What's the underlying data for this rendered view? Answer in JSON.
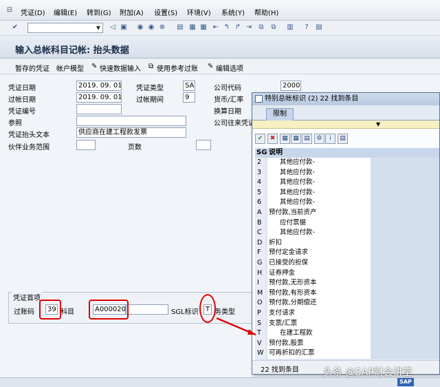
{
  "menu": {
    "items": [
      "凭证(D)",
      "编辑(E)",
      "转到(G)",
      "附加(A)",
      "设置(S)",
      "环境(V)",
      "系统(Y)",
      "帮助(H)"
    ]
  },
  "title": "输入总帐科目记帐: 抬头数据",
  "app_toolbar": {
    "b1": "暂存的凭证",
    "b2": "帐户模型",
    "b3": "快速数据输入",
    "b4": "使用参考过账",
    "b5": "编辑选项"
  },
  "header": {
    "doc_date_label": "凭证日期",
    "doc_date": "2019. 09. 01",
    "doc_type_label": "凭证类型",
    "doc_type": "SA",
    "company_code_label": "公司代码",
    "company_code": "2000",
    "post_date_label": "过帐日期",
    "post_date": "2019. 09. 01",
    "period_label": "过帐期间",
    "period": "9",
    "currency_label": "货币/汇率",
    "doc_no_label": "凭证编号",
    "trans_date_label": "换算日期",
    "reference_label": "参照",
    "cross_cc_label": "公司往来凭证",
    "header_text_label": "凭证抬头文本",
    "header_text": "供应商在建工程款发票",
    "partner_label": "伙伴业务范围",
    "pages_label": "页数"
  },
  "first_item": {
    "section_label": "凭证首项",
    "posting_key_label": "过账码",
    "posting_key": "39",
    "account_label": "科目",
    "account": "A000020",
    "sgl_label": "SGL标识",
    "sgl": "T",
    "trans_type_label": "务类型"
  },
  "popup": {
    "title": "特别总帐标识 (2)   22 找到条目",
    "tab": "限制",
    "col_sg": "SG",
    "col_desc": "说明",
    "rows": [
      {
        "sg": "2",
        "desc": "其他应付款-"
      },
      {
        "sg": "3",
        "desc": "其他应付款-"
      },
      {
        "sg": "4",
        "desc": "其他应付款-"
      },
      {
        "sg": "5",
        "desc": "其他应付款-"
      },
      {
        "sg": "6",
        "desc": "其他应付款-"
      },
      {
        "sg": "A",
        "desc": "预付款,当前资产"
      },
      {
        "sg": "B",
        "desc": "应付票据"
      },
      {
        "sg": "C",
        "desc": "其他应付款-"
      },
      {
        "sg": "D",
        "desc": "折扣"
      },
      {
        "sg": "F",
        "desc": "预付定金请求"
      },
      {
        "sg": "G",
        "desc": "已接受的担保"
      },
      {
        "sg": "H",
        "desc": "证券押金"
      },
      {
        "sg": "I",
        "desc": "预付款,无形资本"
      },
      {
        "sg": "M",
        "desc": "预付款,有形资本"
      },
      {
        "sg": "O",
        "desc": "预付款,分期偿还"
      },
      {
        "sg": "P",
        "desc": "支付请求"
      },
      {
        "sg": "S",
        "desc": "支票/汇票"
      },
      {
        "sg": "T",
        "desc": "在建工程款"
      },
      {
        "sg": "V",
        "desc": "预付款,股票"
      },
      {
        "sg": "W",
        "desc": "可再折扣的汇票"
      }
    ],
    "footer": "22 找到条目"
  },
  "watermark": "头条 @SAP财会讲堂",
  "status": {
    "logo": "SAP"
  }
}
